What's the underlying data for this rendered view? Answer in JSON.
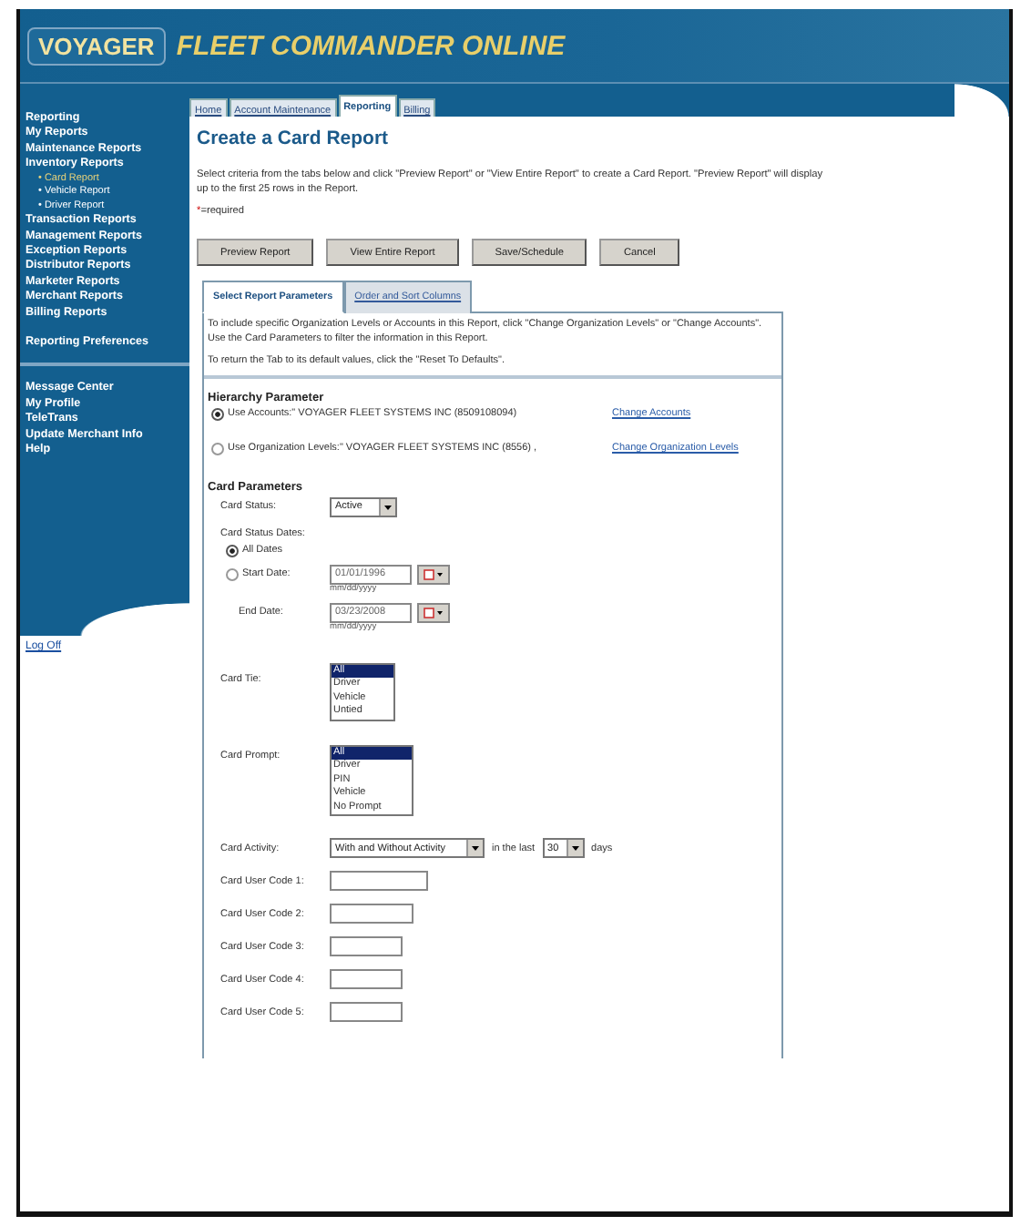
{
  "header": {
    "logo": "VOYAGER",
    "title": "FLEET COMMANDER ONLINE"
  },
  "nav_tabs": [
    {
      "label": "Home",
      "selected": false
    },
    {
      "label": "Account Maintenance",
      "selected": false
    },
    {
      "label": "Reporting",
      "selected": true
    },
    {
      "label": "Billing",
      "selected": false
    }
  ],
  "sidebar": {
    "groups": [
      [
        {
          "label": "Reporting",
          "kind": "main",
          "selected": false
        },
        {
          "label": "My Reports",
          "kind": "main",
          "selected": false
        },
        {
          "label": "Maintenance Reports",
          "kind": "main",
          "selected": false
        },
        {
          "label": "Inventory Reports",
          "kind": "main",
          "selected": false
        },
        {
          "label": "• Card Report",
          "kind": "sub",
          "selected": true
        },
        {
          "label": "• Vehicle Report",
          "kind": "sub",
          "selected": false
        },
        {
          "label": "• Driver Report",
          "kind": "sub",
          "selected": false
        },
        {
          "label": "Transaction Reports",
          "kind": "main",
          "selected": false
        },
        {
          "label": "Management Reports",
          "kind": "main",
          "selected": false
        },
        {
          "label": "Exception Reports",
          "kind": "main",
          "selected": false
        },
        {
          "label": "Distributor Reports",
          "kind": "main",
          "selected": false
        },
        {
          "label": "Marketer Reports",
          "kind": "main",
          "selected": false
        },
        {
          "label": "Merchant Reports",
          "kind": "main",
          "selected": false
        },
        {
          "label": "Billing Reports",
          "kind": "main",
          "selected": false
        },
        {
          "label": "Reporting Preferences",
          "kind": "spaced",
          "selected": false
        }
      ],
      [
        {
          "label": "Message Center",
          "kind": "main",
          "selected": false
        },
        {
          "label": "My Profile",
          "kind": "main",
          "selected": false
        },
        {
          "label": "TeleTrans",
          "kind": "main",
          "selected": false
        },
        {
          "label": "Update Merchant Info",
          "kind": "main",
          "selected": false
        },
        {
          "label": "Help",
          "kind": "main",
          "selected": false
        }
      ]
    ],
    "logoff": "Log Off"
  },
  "page": {
    "title": "Create a Card Report",
    "intro": "Select criteria from the tabs below and click \"Preview Report\" or \"View Entire Report\" to create a Card Report. \"Preview Report\" will display up to the first 25 rows in the Report.",
    "required_mark": "*",
    "required_text": "=required",
    "buttons": [
      "Preview Report",
      "View Entire Report",
      "Save/Schedule",
      "Cancel"
    ]
  },
  "sub_tabs": [
    {
      "label": "Select Report Parameters",
      "selected": true
    },
    {
      "label": "Order and Sort Columns",
      "selected": false
    }
  ],
  "panel": {
    "info": [
      "To include specific Organization Levels or Accounts in this Report, click \"Change Organization Levels\" or \"Change Accounts\". Use the Card Parameters to filter the information in this Report.",
      "To return the Tab to its default values, click the \"Reset To Defaults\"."
    ],
    "hierarchy": {
      "heading": "Hierarchy Parameter",
      "options": [
        {
          "label": "Use Accounts:",
          "value": "\" VOYAGER FLEET SYSTEMS INC (8509108094)",
          "link": "Change Accounts",
          "selected": true
        },
        {
          "label": "Use Organization Levels:",
          "value": "\" VOYAGER FLEET SYSTEMS INC (8556) ,",
          "link": "Change Organization Levels",
          "selected": false
        }
      ]
    },
    "card_params": {
      "heading": "Card Parameters",
      "status": {
        "label": "Card Status:",
        "value": "Active"
      },
      "dates": {
        "label": "Card Status Dates:",
        "all_dates": {
          "label": "All Dates",
          "selected": true
        },
        "start": {
          "label": "Start Date:",
          "value": "01/01/1996",
          "hint": "mm/dd/yyyy",
          "selected": false
        },
        "end": {
          "label": "End Date:",
          "value": "03/23/2008",
          "hint": "mm/dd/yyyy"
        }
      },
      "card_tie": {
        "label": "Card Tie:",
        "options": [
          {
            "label": "All",
            "selected": true
          },
          {
            "label": "Driver",
            "selected": false
          },
          {
            "label": "Vehicle",
            "selected": false
          },
          {
            "label": "Untied",
            "selected": false
          }
        ]
      },
      "card_prompt": {
        "label": "Card Prompt:",
        "options": [
          {
            "label": "All",
            "selected": true
          },
          {
            "label": "Driver",
            "selected": false
          },
          {
            "label": "PIN",
            "selected": false
          },
          {
            "label": "Vehicle",
            "selected": false
          },
          {
            "label": "No Prompt",
            "selected": false
          }
        ]
      },
      "activity": {
        "label": "Card Activity:",
        "value": "With and Without Activity",
        "middle": "in the last",
        "days_value": "30",
        "suffix": "days"
      },
      "user_codes": [
        "Card User Code 1:",
        "Card User Code 2:",
        "Card User Code 3:",
        "Card User Code 4:",
        "Card User Code 5:"
      ]
    }
  }
}
